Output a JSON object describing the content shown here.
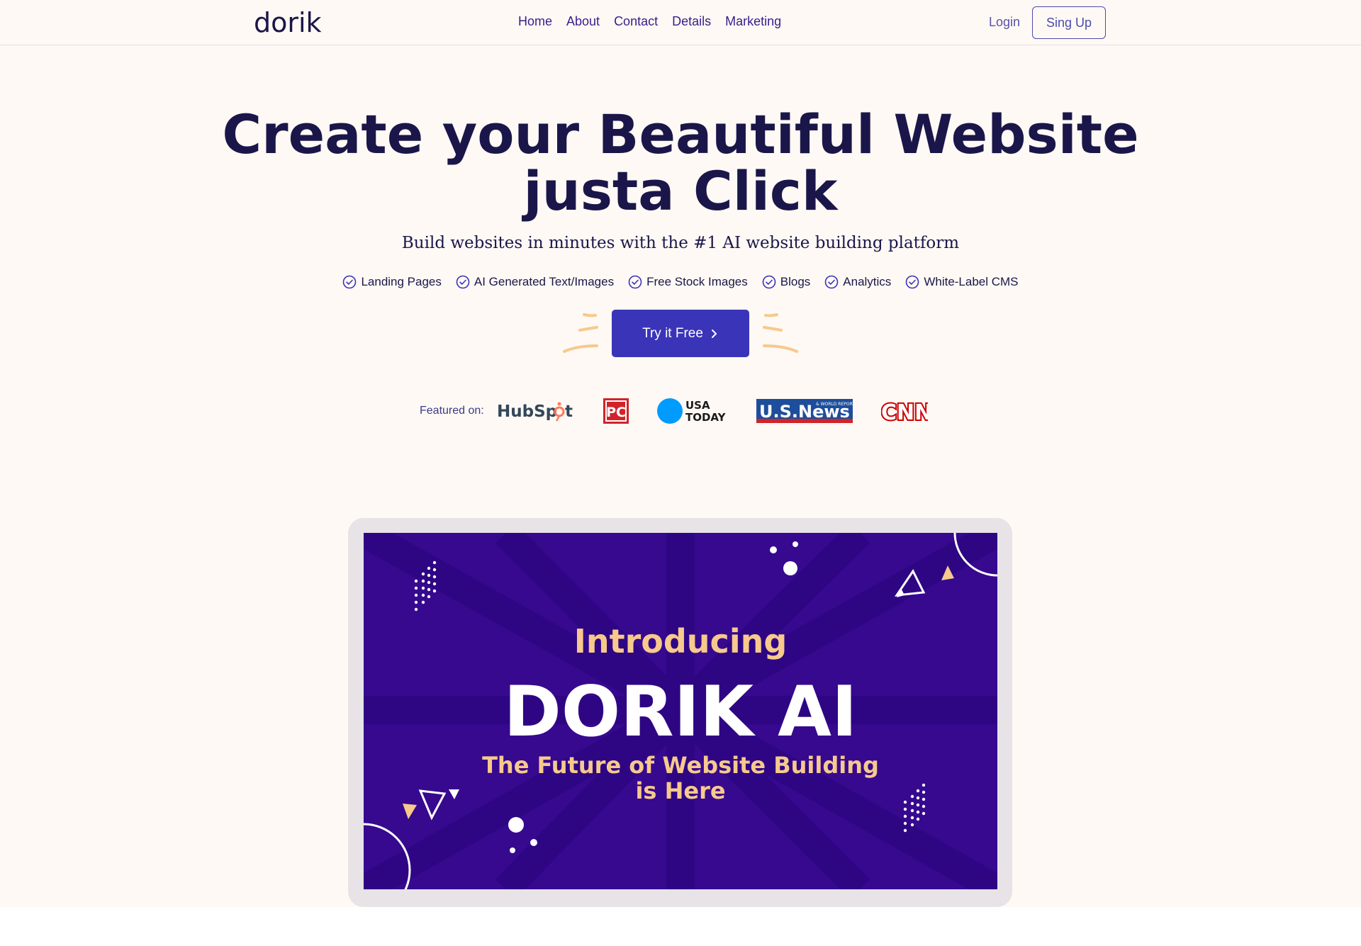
{
  "nav": {
    "logo": "dorik",
    "links": [
      "Home",
      "About",
      "Contact",
      "Details",
      "Marketing"
    ],
    "login": "Login",
    "signup": "Sing Up"
  },
  "hero": {
    "title_line1": "Create your Beautiful Website",
    "title_line2": "justa Click",
    "subtitle": "Build websites in minutes with the #1 AI website building platform",
    "features": [
      "Landing Pages",
      "AI Generated Text/Images",
      "Free Stock Images",
      "Blogs",
      "Analytics",
      "White-Label CMS"
    ],
    "cta": "Try it Free"
  },
  "featured": {
    "label": "Featured on:",
    "brands": [
      "HubSpot",
      "PC",
      "USA TODAY",
      "U.S.News & WORLD REPORT",
      "CNN"
    ]
  },
  "video": {
    "intro": "Introducing",
    "title": "DORIK AI",
    "tagline_line1": "The Future of Website Building",
    "tagline_line2": "is Here"
  },
  "colors": {
    "accent": "#3a34b9",
    "navy": "#1b1649",
    "video_bg": "#36098f",
    "video_yellow": "#f7c98c",
    "background": "#fef9f4"
  },
  "icons": {
    "feature_check": "check-circle-icon",
    "cta_arrow": "chevron-right-icon"
  }
}
